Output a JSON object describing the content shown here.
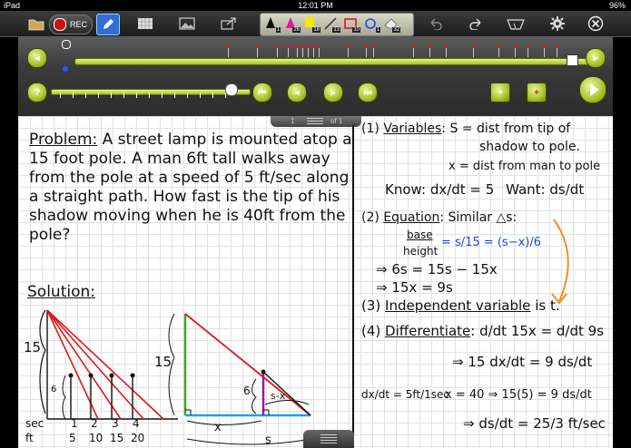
{
  "status": {
    "device": "iPad",
    "time": "12:01 PM",
    "battery": "96%"
  },
  "toolbar": {
    "rec_label": "REC",
    "pens": [
      {
        "color": "#111111",
        "num": "1"
      },
      {
        "color": "#d81ba2",
        "num": "26"
      },
      {
        "color": "#f5e600",
        "num": "18"
      },
      {
        "color": "#9aa02a",
        "num": "13"
      },
      {
        "color": "#e01818",
        "num": "10"
      },
      {
        "color": "#1a4ae0",
        "num": "1"
      },
      {
        "color": "#cfcfcf",
        "num": "32"
      }
    ]
  },
  "pager": {
    "current": "1",
    "total": "of 1"
  },
  "notes": {
    "problem_label": "Problem:",
    "problem_text": "A street lamp is mounted atop a 15 foot pole. A man 6ft tall walks away from the pole at a speed of 5 ft/sec along a straight path. How fast is the tip of his shadow moving when he is 40ft from the pole?",
    "solution_label": "Solution:",
    "step1_num": "1",
    "step1_head": "Variables",
    "step1_a": ": S = dist from tip of",
    "step1_b": "shadow to pole.",
    "step1_c": "x = dist from man to pole",
    "know": "Know:",
    "know_eq": "dx/dt = 5",
    "want": "Want:",
    "want_eq": "ds/dt",
    "step2_num": "2",
    "step2_head": "Equation",
    "step2_a": ": Similar △s:",
    "base": "base",
    "height": "height",
    "ratio": "=  s/15  =  (s−x)/6",
    "eq1": "⇒ 6s = 15s − 15x",
    "eq2": "⇒ 15x = 9s",
    "step3_num": "3",
    "step3_head": "Independent variable",
    "step3_tail": "is t.",
    "step4_num": "4",
    "step4_head": "Differentiate",
    "d1": ": d/dt 15x = d/dt 9s",
    "d2": "⇒ 15 dx/dt = 9 ds/dt",
    "given": "dx/dt = 5ft/1sec",
    "x40": "x = 40 ⇒ 15(5) = 9 ds/dt",
    "final": "⇒ ds/dt = 25/3 ft/sec",
    "fig1_15": "15",
    "fig1_6": "6",
    "sec_label": "sec",
    "ft_label": "ft",
    "secs": [
      "1",
      "2",
      "3",
      "4"
    ],
    "fts": [
      "5",
      "10",
      "15",
      "20"
    ],
    "fig2_15": "15",
    "fig2_6": "6",
    "fig2_sx": "s-x",
    "fig2_x": "x",
    "fig2_s": "s"
  }
}
